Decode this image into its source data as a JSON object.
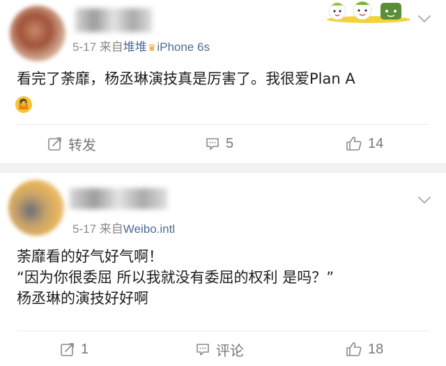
{
  "posts": [
    {
      "username": "",
      "date": "5-17",
      "source_prefix": "来自",
      "source_name": "堆堆",
      "source_device": "iPhone 6s",
      "content_lines": [
        "看完了荼靡，杨丞琳演技真是厉害了。我很爱Plan A"
      ],
      "emoji": "shrug-emoji",
      "actions": {
        "repost_label": "转发",
        "comment_count": "5",
        "like_count": "14"
      }
    },
    {
      "username": "",
      "date": "5-17",
      "source_prefix": "来自",
      "source_name": "Weibo.intl",
      "source_device": "",
      "content_lines": [
        "荼靡看的好气好气啊！",
        "“因为你很委屈 所以我就没有委屈的权利 是吗？”",
        "杨丞琳的演技好好啊"
      ],
      "emoji": "",
      "actions": {
        "repost_count": "1",
        "comment_label": "评论",
        "like_count": "18"
      }
    }
  ],
  "icons": {
    "repost": "repost-icon",
    "comment": "comment-icon",
    "like": "thumbs-up-icon",
    "menu": "chevron-down-icon",
    "badge": "cartoon-badge-icon"
  },
  "colors": {
    "text": "#1c1c1c",
    "meta": "#8a8a8a",
    "source_link": "#4a6b93",
    "action": "#777777",
    "separator": "#f2f2f2",
    "divider": "#ececec"
  }
}
